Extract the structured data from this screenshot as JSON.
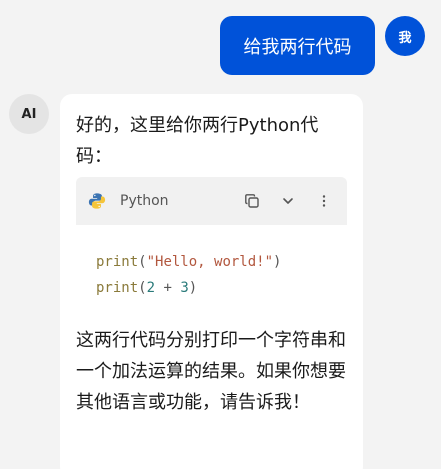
{
  "user_message": {
    "avatar_label": "我",
    "text": "给我两行代码"
  },
  "ai_message": {
    "avatar_label": "AI",
    "intro": "好的，这里给你两行Python代码：",
    "code": {
      "language": "Python",
      "icons": [
        "python-logo-icon",
        "copy-icon",
        "chevron-down-icon",
        "more-vertical-icon"
      ],
      "line1": {
        "func": "print",
        "open": "(",
        "string": "\"Hello, world!\"",
        "close": ")"
      },
      "line2": {
        "func": "print",
        "open": "(",
        "a": "2",
        "op": " + ",
        "b": "3",
        "close": ")"
      }
    },
    "outro": "这两行代码分别打印一个字符串和一个加法运算的结果。如果你想要其他语言或功能，请告诉我！"
  },
  "colors": {
    "accent": "#0052d9",
    "background": "#f3f3f3",
    "bubble": "#ffffff"
  }
}
